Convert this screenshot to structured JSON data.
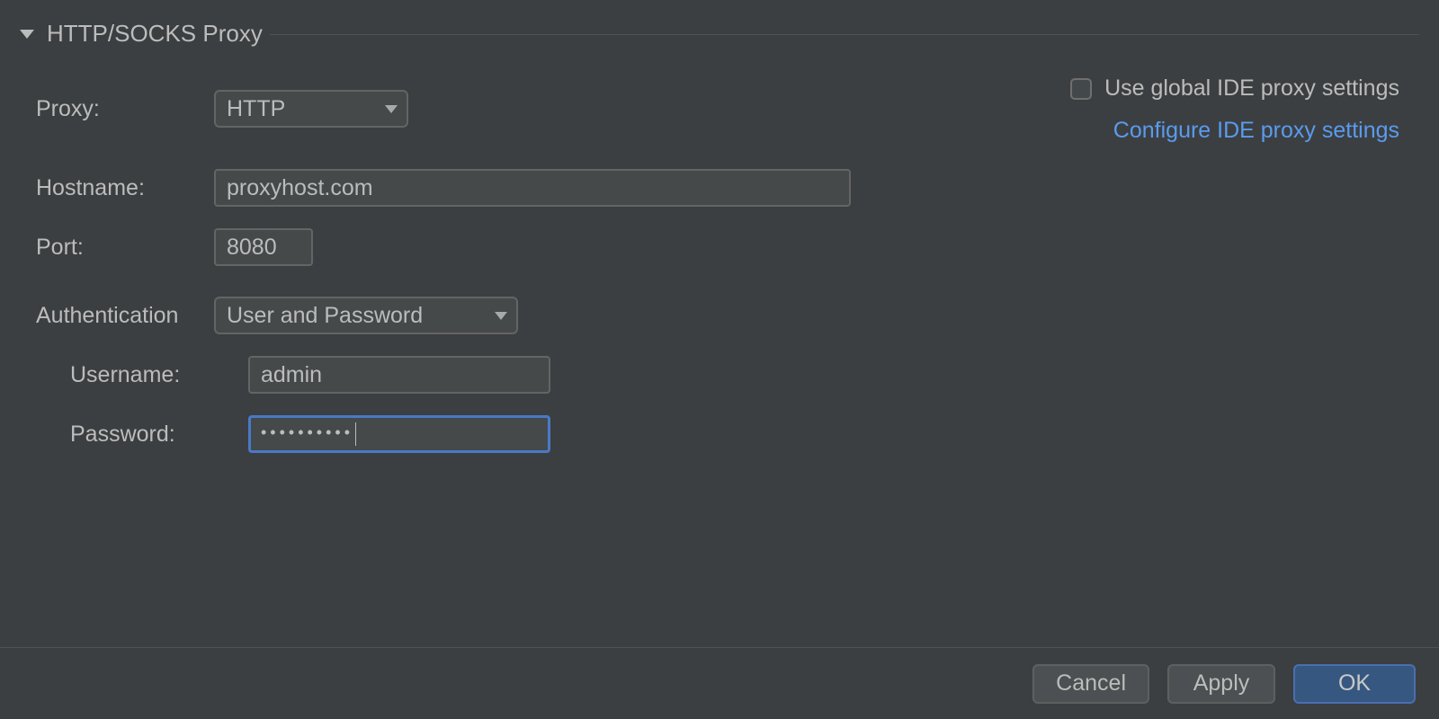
{
  "section": {
    "title": "HTTP/SOCKS Proxy"
  },
  "form": {
    "proxy_label": "Proxy:",
    "proxy_value": "HTTP",
    "hostname_label": "Hostname:",
    "hostname_value": "proxyhost.com",
    "port_label": "Port:",
    "port_value": "8080",
    "auth_label": "Authentication",
    "auth_value": "User and Password",
    "username_label": "Username:",
    "username_value": "admin",
    "password_label": "Password:",
    "password_mask": "••••••••••"
  },
  "right": {
    "use_global_label": "Use global IDE proxy settings",
    "configure_link": "Configure IDE proxy settings"
  },
  "footer": {
    "cancel": "Cancel",
    "apply": "Apply",
    "ok": "OK"
  }
}
